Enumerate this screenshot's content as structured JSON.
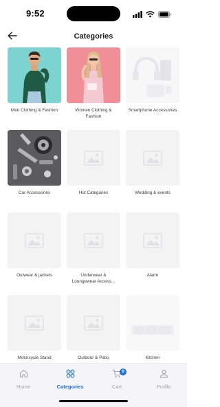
{
  "status": {
    "time": "9:52"
  },
  "header": {
    "title": "Categories"
  },
  "categories": [
    {
      "label": "Men Clothing & Fashion",
      "image": "men-photo"
    },
    {
      "label": "Women Clothing & Fashion",
      "image": "women-photo"
    },
    {
      "label": "Smartphone Accessories",
      "image": "faded-placeholder"
    },
    {
      "label": "Car Accessories",
      "image": "car-parts-photo"
    },
    {
      "label": "Hot Categories",
      "image": "placeholder"
    },
    {
      "label": "Wedding & events",
      "image": "placeholder"
    },
    {
      "label": "Outwear & jackets",
      "image": "placeholder"
    },
    {
      "label": "Underwear & Loungewear Access...",
      "image": "placeholder"
    },
    {
      "label": "Alarm",
      "image": "placeholder"
    },
    {
      "label": "Motorcycle Stand",
      "image": "placeholder"
    },
    {
      "label": "Outdoor & Patio",
      "image": "placeholder"
    },
    {
      "label": "Kitchen",
      "image": "placeholder"
    }
  ],
  "tabbar": {
    "home": "Home",
    "categories": "Categories",
    "cart": "Cart",
    "cart_count": "0",
    "profile": "Profile"
  },
  "colors": {
    "accent": "#1f6fde",
    "inactive": "#a2a2a8",
    "placeholder_bg": "#f3f3f4"
  }
}
